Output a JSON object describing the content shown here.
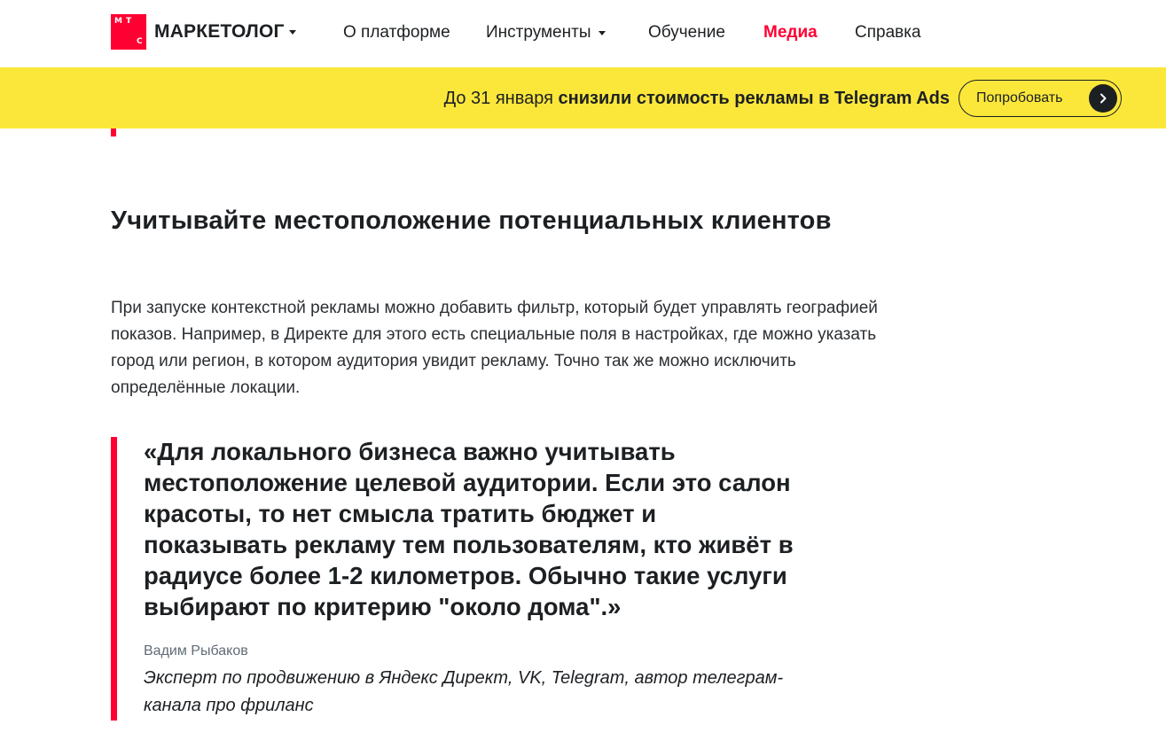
{
  "header": {
    "logo_letters": [
      "М",
      "Т",
      "С"
    ],
    "brand": "МАРКЕТОЛОГ",
    "nav": [
      {
        "label": "О платформе"
      },
      {
        "label": "Инструменты"
      },
      {
        "label": "Обучение"
      },
      {
        "label": "Медиа"
      },
      {
        "label": "Справка"
      }
    ],
    "active_color": "#ff0032"
  },
  "promo": {
    "text_prefix": "До 31 января ",
    "text_bold": "снизили стоимость рекламы в Telegram Ads",
    "button_label": "Попробовать",
    "background": "#fbe73a"
  },
  "article": {
    "heading": "Учитывайте местоположение потенциальных клиентов",
    "paragraph": "При запуске контекстной рекламы можно добавить фильтр, который будет управлять географией показов. Например, в Директе для этого есть специальные поля в настройках, где можно указать город или регион, в котором аудитория увидит рекламу. Точно так же можно  исключить определённые локации.",
    "quote": {
      "text": "«Для локального бизнеса важно учитывать местоположение целевой аудитории. Если это салон красоты, то нет смысла тратить бюджет и показывать рекламу тем пользователям, кто живёт в радиусе более 1-2 километров. Обычно такие услуги выбирают по критерию \"около дома\".»",
      "author_name": "Вадим Рыбаков",
      "author_role": "Эксперт по продвижению в Яндекс Директ, VK, Telegram, автор телеграм-канала про фриланс",
      "accent_color": "#ff0032"
    }
  }
}
